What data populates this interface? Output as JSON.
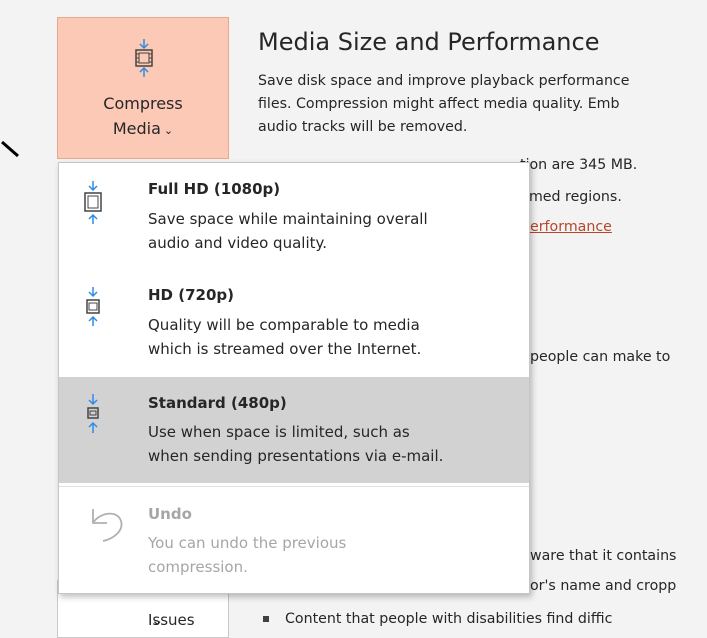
{
  "compress_button": {
    "line1": "Compress",
    "line2": "Media",
    "chevron": "⌄"
  },
  "section": {
    "title": "Media Size and Performance",
    "desc_line1": "Save disk space and improve playback performance",
    "desc_line2": "files. Compression might affect media quality. Emb",
    "desc_line3": "audio tracks will be removed.",
    "partial1": "tion are 345 MB.",
    "partial2": "nmed regions.",
    "partial3_link": "erformance",
    "partial4": "people can make to"
  },
  "menu": {
    "options": [
      {
        "title": "Full HD (1080p)",
        "line1": "Save space while maintaining overall",
        "line2": "audio and video quality.",
        "icon": "film-compress-large-icon"
      },
      {
        "title": "HD (720p)",
        "line1": "Quality will be comparable to media",
        "line2": "which is streamed over the Internet.",
        "icon": "film-compress-medium-icon"
      },
      {
        "title": "Standard (480p)",
        "line1": "Use when space is limited, such as",
        "line2": "when sending presentations via e-mail.",
        "icon": "film-compress-small-icon"
      },
      {
        "title": "Undo",
        "line1": "You can undo the previous",
        "line2": "compression.",
        "icon": "undo-icon"
      }
    ]
  },
  "issues": {
    "label": "Issues",
    "chevron": "⌄"
  },
  "inspect": {
    "partial5": "ware that it contains",
    "partial6": "or's name and cropp",
    "bullet_text": "Content that people with disabilities find diffic"
  },
  "colors": {
    "accent": "#fbc9b6",
    "selected": "#d2d2d2",
    "link": "#b7472a",
    "icon_blue": "#2e8be6"
  }
}
